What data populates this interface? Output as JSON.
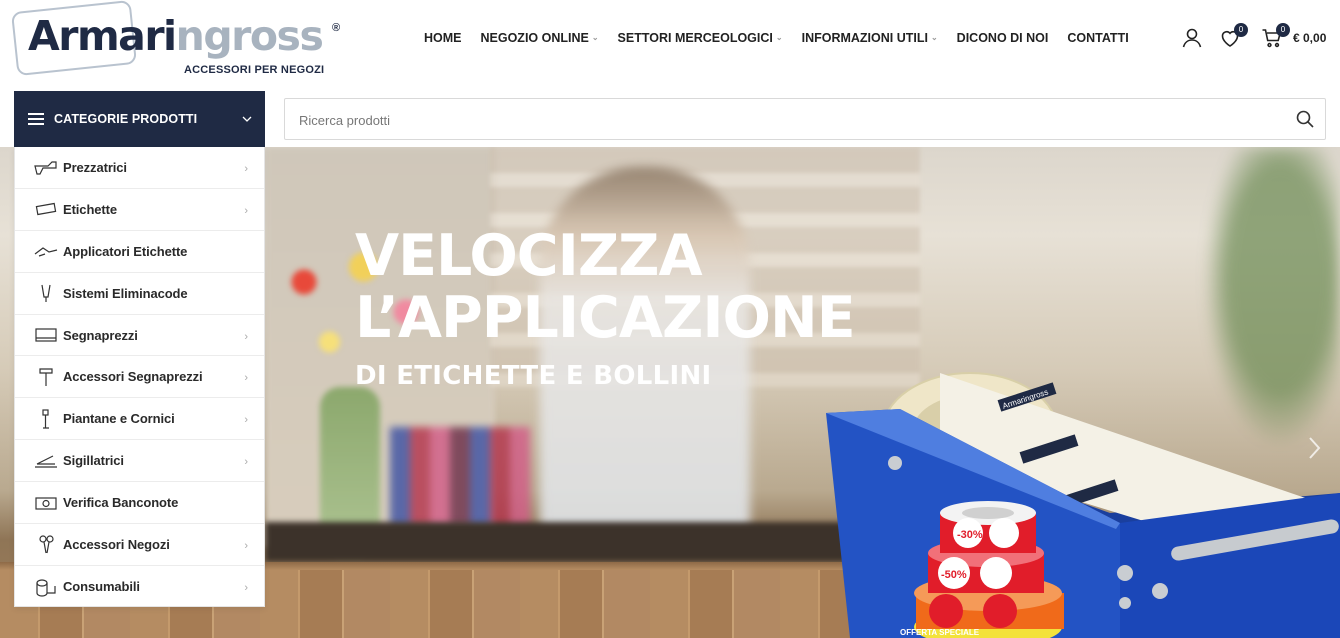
{
  "logo": {
    "text_dark": "Armari",
    "text_light": "ngross",
    "reg": "®",
    "subtitle": "ACCESSORI PER NEGOZI"
  },
  "nav": [
    {
      "label": "HOME",
      "dropdown": false
    },
    {
      "label": "NEGOZIO ONLINE",
      "dropdown": true
    },
    {
      "label": "SETTORI MERCEOLOGICI",
      "dropdown": true
    },
    {
      "label": "INFORMAZIONI UTILI",
      "dropdown": true
    },
    {
      "label": "DICONO DI NOI",
      "dropdown": false
    },
    {
      "label": "CONTATTI",
      "dropdown": false
    }
  ],
  "header_icons": {
    "account": "user-icon",
    "wishlist": "heart-icon",
    "wishlist_count": "0",
    "cart": "cart-icon",
    "cart_count": "0",
    "cart_total": "€ 0,00"
  },
  "categories_bar": {
    "label": "CATEGORIE PRODOTTI"
  },
  "search": {
    "placeholder": "Ricerca prodotti",
    "value": ""
  },
  "categories": [
    {
      "label": "Prezzatrici",
      "icon": "price-gun-icon",
      "has_sub": true
    },
    {
      "label": "Etichette",
      "icon": "label-tag-icon",
      "has_sub": true
    },
    {
      "label": "Applicatori Etichette",
      "icon": "label-applicator-icon",
      "has_sub": false
    },
    {
      "label": "Sistemi Eliminacode",
      "icon": "queue-ticket-icon",
      "has_sub": false
    },
    {
      "label": "Segnaprezzi",
      "icon": "price-sign-icon",
      "has_sub": true
    },
    {
      "label": "Accessori Segnaprezzi",
      "icon": "sign-holder-icon",
      "has_sub": true
    },
    {
      "label": "Piantane e Cornici",
      "icon": "stand-frame-icon",
      "has_sub": true
    },
    {
      "label": "Sigillatrici",
      "icon": "sealer-icon",
      "has_sub": true
    },
    {
      "label": "Verifica Banconote",
      "icon": "banknote-checker-icon",
      "has_sub": false
    },
    {
      "label": "Accessori Negozi",
      "icon": "shop-accessory-icon",
      "has_sub": true
    },
    {
      "label": "Consumabili",
      "icon": "roll-icon",
      "has_sub": true
    }
  ],
  "hero": {
    "title_line1": "VELOCIZZA",
    "title_line2": "L’APPLICAZIONE",
    "subtitle": "DI ETICHETTE E BOLLINI",
    "roll_texts": [
      "-30%",
      "-50%",
      "OFFERTA SPECIALE"
    ],
    "label_brand": "Armaringross"
  },
  "colors": {
    "brand_navy": "#1f2a44",
    "brand_grey": "#a8b3bf",
    "hero_text": "#ffffff",
    "dispenser_blue": "#1b47b8",
    "sticker_red": "#e11d2a",
    "sticker_orange": "#f06a1a"
  }
}
